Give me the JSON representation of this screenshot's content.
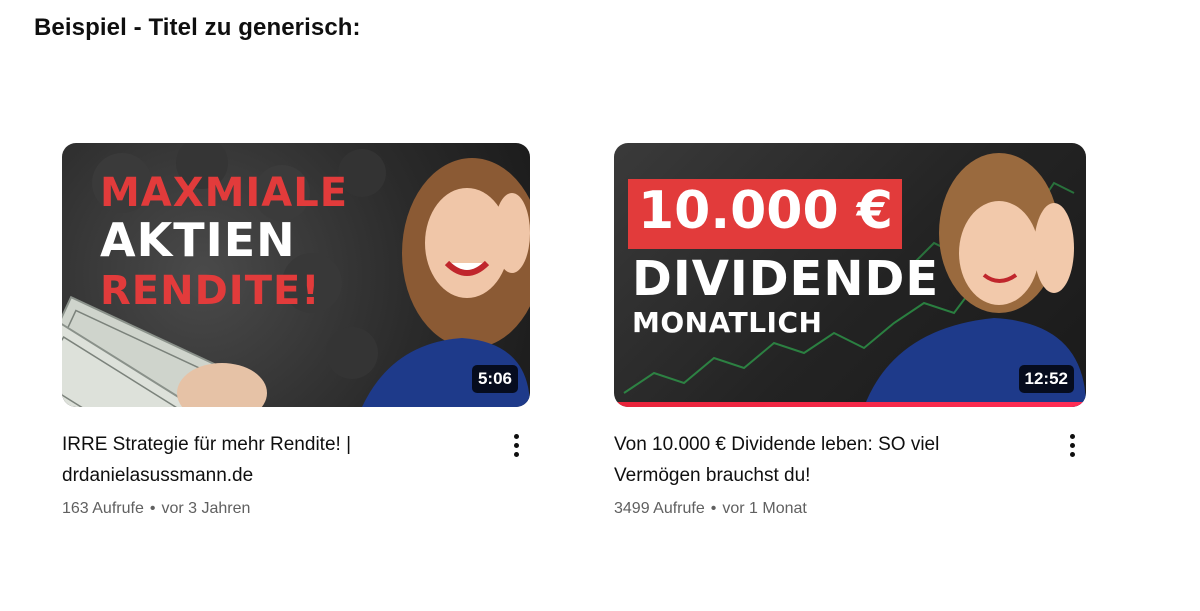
{
  "heading": "Beispiel - Titel zu generisch:",
  "videos": [
    {
      "thumbnail": {
        "lines": [
          "MAXMIALE",
          "AKTIEN",
          "RENDITE!"
        ],
        "duration": "5:06"
      },
      "title_line1": "IRRE Strategie für mehr Rendite! |",
      "title_line2": "drdanielasussmann.de",
      "views": "163 Aufrufe",
      "separator": "•",
      "age": "vor 3 Jahren"
    },
    {
      "thumbnail": {
        "lines": [
          "10.000 €",
          "DIVIDENDE",
          "MONATLICH"
        ],
        "duration": "12:52",
        "watched_fraction": 1.0
      },
      "title_line1": "Von 10.000 € Dividende leben: SO viel",
      "title_line2": "Vermögen brauchst du!",
      "views": "3499 Aufrufe",
      "separator": "•",
      "age": "vor 1 Monat"
    }
  ],
  "colors": {
    "accent_red": "#e23b3b",
    "progress_red": "#ff2c55",
    "text_primary": "#0f0f0f",
    "text_secondary": "#606060"
  },
  "icons": {
    "menu": "more-vertical-icon"
  }
}
